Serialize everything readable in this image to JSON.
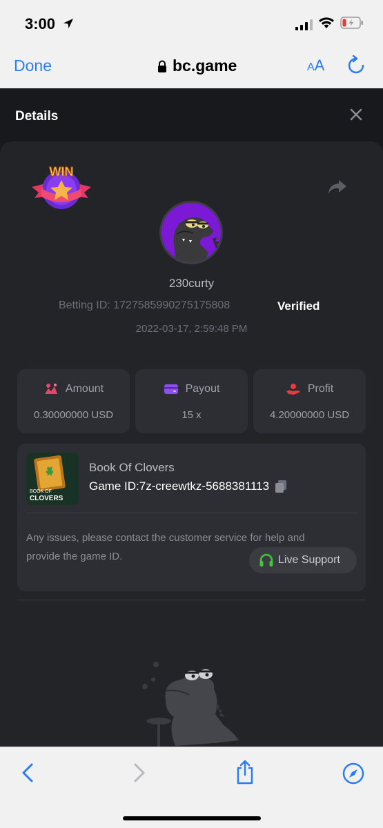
{
  "status_bar": {
    "time": "3:00",
    "icons": [
      "location-arrow-icon",
      "signal-icon",
      "wifi-icon",
      "battery-icon"
    ]
  },
  "browser": {
    "done_label": "Done",
    "url": "bc.game",
    "text_size_label_small": "A",
    "text_size_label_large": "A",
    "icons": [
      "lock-icon",
      "reload-icon",
      "back-icon",
      "forward-icon",
      "share-icon",
      "compass-icon"
    ]
  },
  "details": {
    "title": "Details",
    "badge_text": "WIN",
    "username": "230curty",
    "betting_id": "Betting ID: 1727585990275175808",
    "verified": "Verified",
    "datetime": "2022-03-17, 2:59:48 PM"
  },
  "stats": [
    {
      "label": "Amount",
      "value": "0.30000000 USD",
      "icon": "bet-amount-icon",
      "color": "#e8456b"
    },
    {
      "label": "Payout",
      "value": "15 x",
      "icon": "card-icon",
      "color": "#8e4ef0"
    },
    {
      "label": "Profit",
      "value": "4.20000000 USD",
      "icon": "hand-coin-icon",
      "color": "#e63b3b"
    }
  ],
  "game": {
    "name": "Book Of Clovers",
    "id_text": "Game ID:7z-creewtkz-5688381113",
    "thumb_text_1": "BOOK OF",
    "thumb_text_2": "CLOVERS",
    "issue_line_1": "Any issues, please contact the customer service for help and",
    "issue_line_2": "provide the game ID.",
    "live_support": "Live Support"
  },
  "colors": {
    "accent_blue": "#2a7cf6",
    "dark_bg": "#18191c",
    "card_bg": "#232428",
    "support_green": "#3fc93a"
  }
}
